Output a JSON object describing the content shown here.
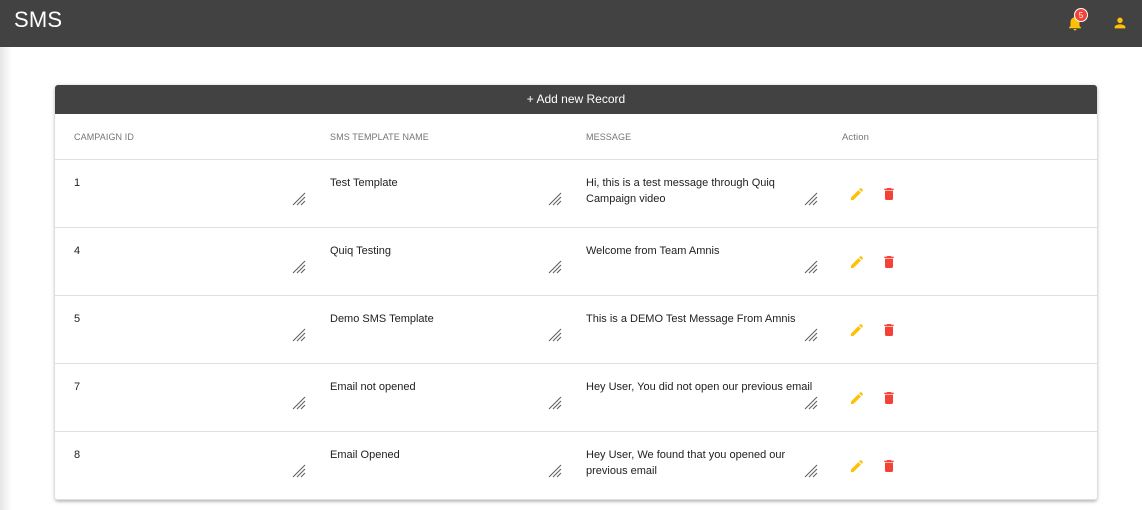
{
  "app": {
    "title": "SMS",
    "notification_count": "5"
  },
  "toolbar": {
    "add_label": "+ Add new Record"
  },
  "table": {
    "headers": [
      "CAMPAIGN ID",
      "SMS TEMPLATE NAME",
      "MESSAGE",
      "Action"
    ],
    "rows": [
      {
        "campaign_id": "1",
        "template_name": "Test Template",
        "message": "Hi, this is a test message through Quiq Campaign video"
      },
      {
        "campaign_id": "4",
        "template_name": "Quiq Testing",
        "message": "Welcome from Team Amnis"
      },
      {
        "campaign_id": "5",
        "template_name": "Demo SMS Template",
        "message": "This is a DEMO Test Message From Amnis"
      },
      {
        "campaign_id": "7",
        "template_name": "Email not opened",
        "message": "Hey User, You did not open our previous email"
      },
      {
        "campaign_id": "8",
        "template_name": "Email Opened",
        "message": "Hey User, We found that you opened our previous email"
      }
    ]
  },
  "icons": {
    "notifications": "bell-icon",
    "account": "user-icon",
    "edit": "pencil-icon",
    "delete": "trash-icon",
    "resize": "resize-handle-icon"
  },
  "colors": {
    "topbar": "#424242",
    "accent": "#ffc107",
    "delete": "#f44336",
    "badge": "#f44336"
  }
}
